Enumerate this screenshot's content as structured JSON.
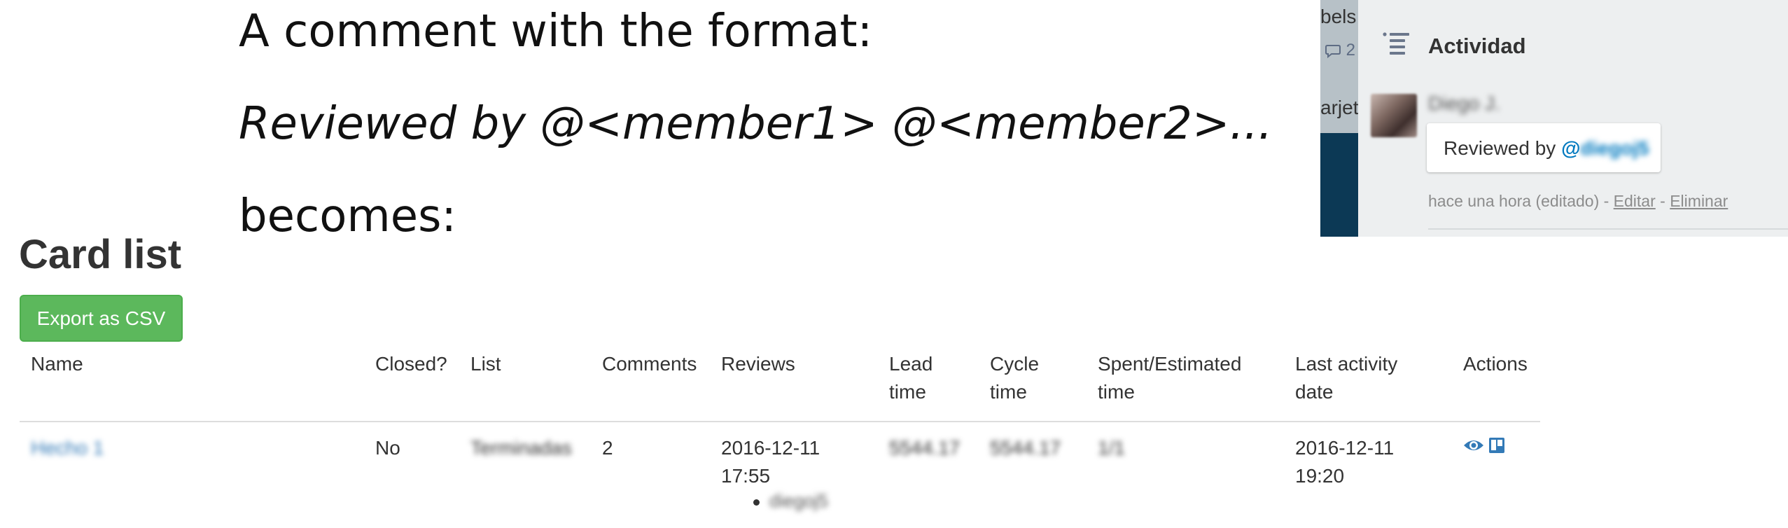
{
  "explanation": {
    "line1": "A comment with the format:",
    "line2": "Reviewed by @<member1> @<member2>...",
    "line3": "becomes:"
  },
  "trello_panel": {
    "background_text_top": "bels",
    "background_comment_count": "2",
    "background_text_mid": "arjeta",
    "activity_title": "Actividad",
    "author_name": "Diego J.",
    "comment_prefix": "Reviewed by ",
    "mention_at": "@",
    "mention_name": "diegoj5",
    "meta_time": "hace una hora (editado) - ",
    "edit_link": "Editar",
    "meta_dash": " - ",
    "delete_link": "Eliminar",
    "icons": [
      "activity-list-icon",
      "comment-bubble-icon"
    ]
  },
  "page": {
    "title": "Card list",
    "export_button": "Export as CSV"
  },
  "table": {
    "headers": {
      "name": "Name",
      "closed": "Closed?",
      "list": "List",
      "comments": "Comments",
      "reviews": "Reviews",
      "lead_time_1": "Lead",
      "lead_time_2": "time",
      "cycle_time_1": "Cycle",
      "cycle_time_2": "time",
      "spent_1": "Spent/Estimated",
      "spent_2": "time",
      "last_activity_1": "Last activity",
      "last_activity_2": "date",
      "actions": "Actions"
    },
    "rows": [
      {
        "name": "Hecho 1",
        "closed": "No",
        "list": "Terminadas",
        "comments": "2",
        "review_date_1": "2016-12-11",
        "review_date_2": "17:55",
        "reviewer": "diegoj5",
        "lead_time": "5544.17",
        "cycle_time": "5544.17",
        "spent_estimated": "1/1",
        "last_activity_1": "2016-12-11",
        "last_activity_2": "19:20"
      }
    ],
    "action_icons": [
      "eye-icon",
      "trello-board-icon"
    ]
  },
  "colors": {
    "export_button": "#5cb85c",
    "link": "#337ab7",
    "mention": "#0079bf"
  }
}
